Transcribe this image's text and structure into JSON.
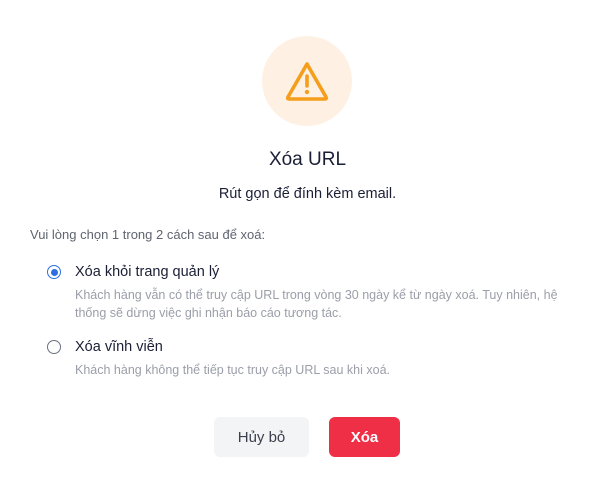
{
  "dialog": {
    "title": "Xóa URL",
    "subtitle": "Rút gọn để đính kèm email.",
    "instruction": "Vui lòng chọn 1 trong 2 cách sau để xoá:",
    "icon": "warning-triangle-icon",
    "options": [
      {
        "label": "Xóa khỏi trang quản lý",
        "description": "Khách hàng vẫn có thể truy cập URL trong vòng 30 ngày kể từ ngày xoá. Tuy nhiên, hệ thống sẽ dừng việc ghi nhận báo cáo tương tác.",
        "selected": true
      },
      {
        "label": "Xóa vĩnh viễn",
        "description": "Khách hàng không thể tiếp tục truy cập URL sau khi xoá.",
        "selected": false
      }
    ],
    "buttons": {
      "cancel_label": "Hủy bỏ",
      "delete_label": "Xóa"
    },
    "colors": {
      "accent_warning": "#f59e1b",
      "warning_bg": "#fef1e4",
      "radio_selected": "#2d6fe3",
      "delete_button": "#ef2f45",
      "cancel_button": "#f3f4f6"
    }
  }
}
